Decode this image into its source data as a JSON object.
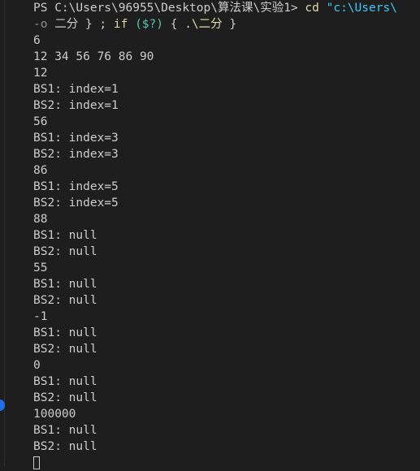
{
  "terminal": {
    "prompt": {
      "ps": "PS C:\\Users\\96955\\Desktop\\算法课\\实验1>",
      "cmd": "cd",
      "path": "\"c:\\Users\\"
    },
    "cont": {
      "flag": "-o",
      "name": "二分",
      "brace": "} ;",
      "kw": "if",
      "cond": "($?)",
      "open": "{",
      "exe": ".\\二分",
      "close": "}"
    },
    "output": [
      "6",
      "12 34 56 76 86 90",
      "12",
      "BS1: index=1",
      "BS2: index=1",
      "56",
      "BS1: index=3",
      "BS2: index=3",
      "86",
      "BS1: index=5",
      "BS2: index=5",
      "88",
      "BS1: null",
      "BS2: null",
      "55",
      "BS1: null",
      "BS2: null",
      "-1",
      "BS1: null",
      "BS2: null",
      "0",
      "BS1: null",
      "BS2: null",
      "100000",
      "BS1: null",
      "BS2: null"
    ]
  }
}
